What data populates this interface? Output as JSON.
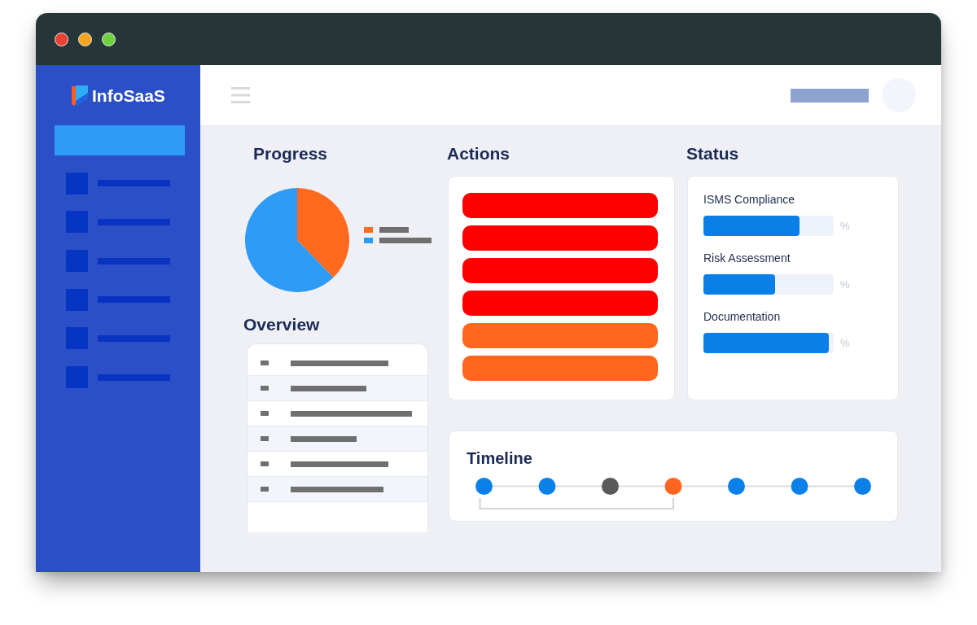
{
  "window": {
    "controls": [
      {
        "kind": "close"
      },
      {
        "kind": "minimize"
      },
      {
        "kind": "maximize"
      }
    ]
  },
  "sidebar": {
    "logo": "InfoSaaS",
    "items": [
      {
        "selected": true
      },
      {
        "selected": false
      },
      {
        "selected": false
      },
      {
        "selected": false
      },
      {
        "selected": false
      },
      {
        "selected": false
      },
      {
        "selected": false
      }
    ]
  },
  "progress": {
    "title": "Progress",
    "legend": [
      {
        "color": "#ff6a1f"
      },
      {
        "color": "#2e9bf5"
      }
    ]
  },
  "overview": {
    "title": "Overview"
  },
  "actions": {
    "title": "Actions",
    "items": [
      {
        "color": "#ff0000"
      },
      {
        "color": "#ff0000"
      },
      {
        "color": "#ff0000"
      },
      {
        "color": "#ff0000"
      },
      {
        "color": "#ff661e"
      },
      {
        "color": "#ff661e"
      }
    ]
  },
  "status": {
    "title": "Status",
    "metrics": [
      {
        "name": "ISMS Compliance",
        "level": 0.74,
        "reading": "%"
      },
      {
        "name": "Risk Assessment",
        "level": 0.55,
        "reading": "%"
      },
      {
        "name": "Documentation",
        "level": 0.96,
        "reading": "%"
      }
    ]
  },
  "timeline": {
    "title": "Timeline",
    "points": [
      {
        "color": "#0a80e8"
      },
      {
        "color": "#0a80e8"
      },
      {
        "color": "#5a5a5a"
      },
      {
        "color": "#ff6420"
      },
      {
        "color": "#0a80e8"
      },
      {
        "color": "#0a80e8"
      },
      {
        "color": "#0a80e8"
      }
    ]
  }
}
